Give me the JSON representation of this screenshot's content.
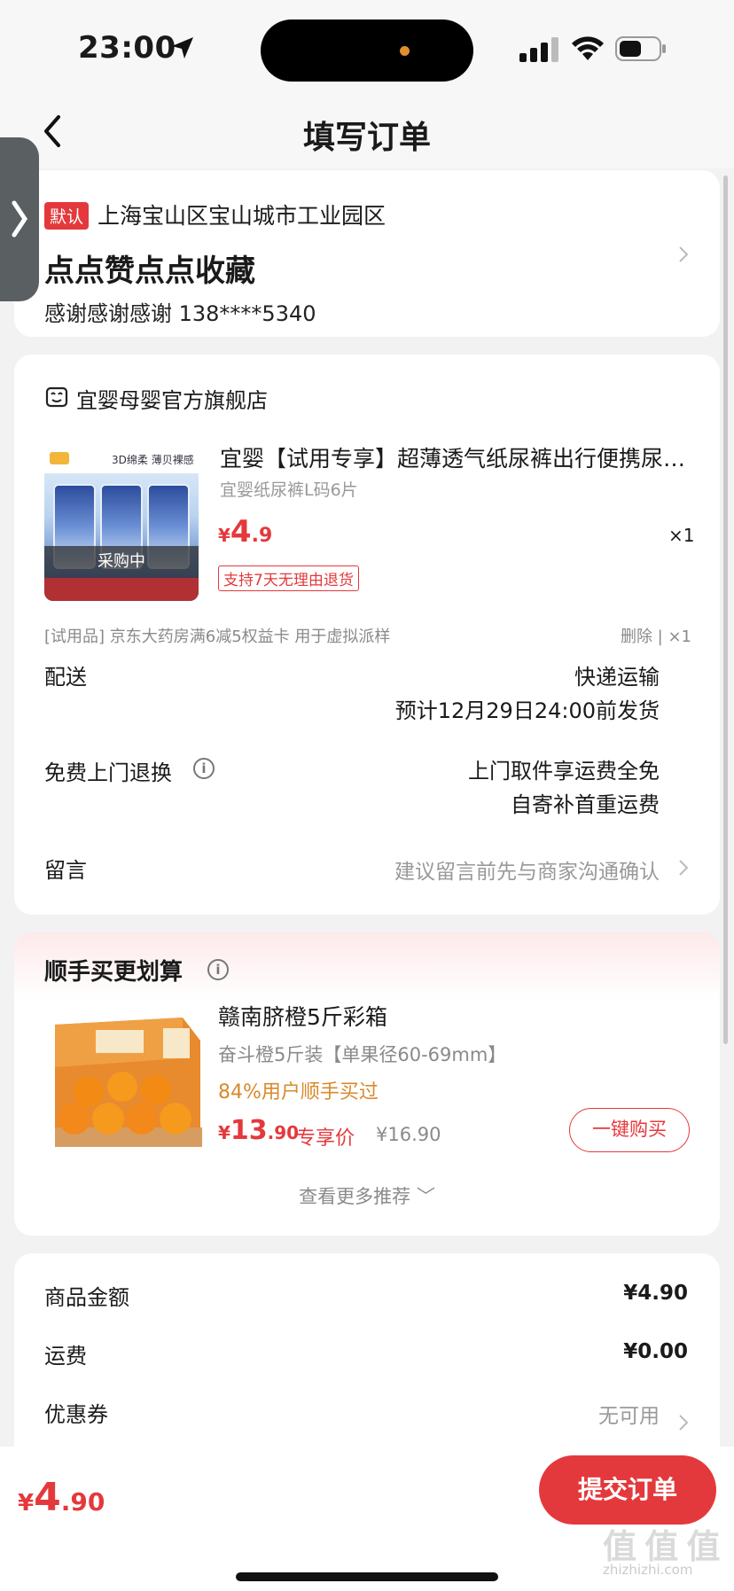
{
  "status_bar": {
    "time": "23:00"
  },
  "header": {
    "title": "填写订单"
  },
  "address": {
    "badge": "默认",
    "line": "上海宝山区宝山城市工业园区",
    "name": "点点赞点点收藏",
    "contact": "感谢感谢感谢  138****5340"
  },
  "shop": {
    "name": "宜婴母婴官方旗舰店",
    "product": {
      "title": "宜婴【试用专享】超薄透气纸尿裤出行便携尿…",
      "spec": "宜婴纸尿裤L码6片",
      "price_symbol": "¥",
      "price_int": "4",
      "price_dec": ".9",
      "qty": "×1",
      "return_tag": "支持7天无理由退货",
      "thumb_overlay": "采购中",
      "thumb_badge": "3D绵柔 薄贝裸感"
    },
    "trial_line": "[试用品] 京东大药房满6减5权益卡 用于虚拟派样",
    "trial_actions": "删除 | ×1",
    "delivery": {
      "label": "配送",
      "value1": "快递运输",
      "value2": "预计12月29日24:00前发货"
    },
    "return": {
      "label": "免费上门退换",
      "value1": "上门取件享运费全免",
      "value2": "自寄补首重运费",
      "info": "i"
    },
    "message": {
      "label": "留言",
      "hint": "建议留言前先与商家沟通确认"
    }
  },
  "recommend": {
    "title": "顺手买更划算",
    "info": "i",
    "name": "赣南脐橙5斤彩箱",
    "spec": "奋斗橙5斤装【单果径60-69mm】",
    "bought": "84%用户顺手买过",
    "price_symbol": "¥",
    "price_int": "13",
    "price_dec": ".90",
    "price_tag": "专享价",
    "orig_price": "¥16.90",
    "buy_label": "一键购买",
    "more": "查看更多推荐 ﹀"
  },
  "summary": {
    "goods_label": "商品金额",
    "goods_value": "¥4.90",
    "shipping_label": "运费",
    "shipping_value": "¥0.00",
    "coupon_label": "优惠券",
    "coupon_value": "无可用"
  },
  "bottom": {
    "total_symbol": "¥",
    "total_int": "4",
    "total_dec": ".90",
    "submit_label": "提交订单"
  },
  "watermark": {
    "text": "值 值 值",
    "sub": "zhizhizhi.com"
  },
  "colors": {
    "accent": "#e4393c",
    "highlight": "#d88a2c",
    "muted": "#999999"
  }
}
